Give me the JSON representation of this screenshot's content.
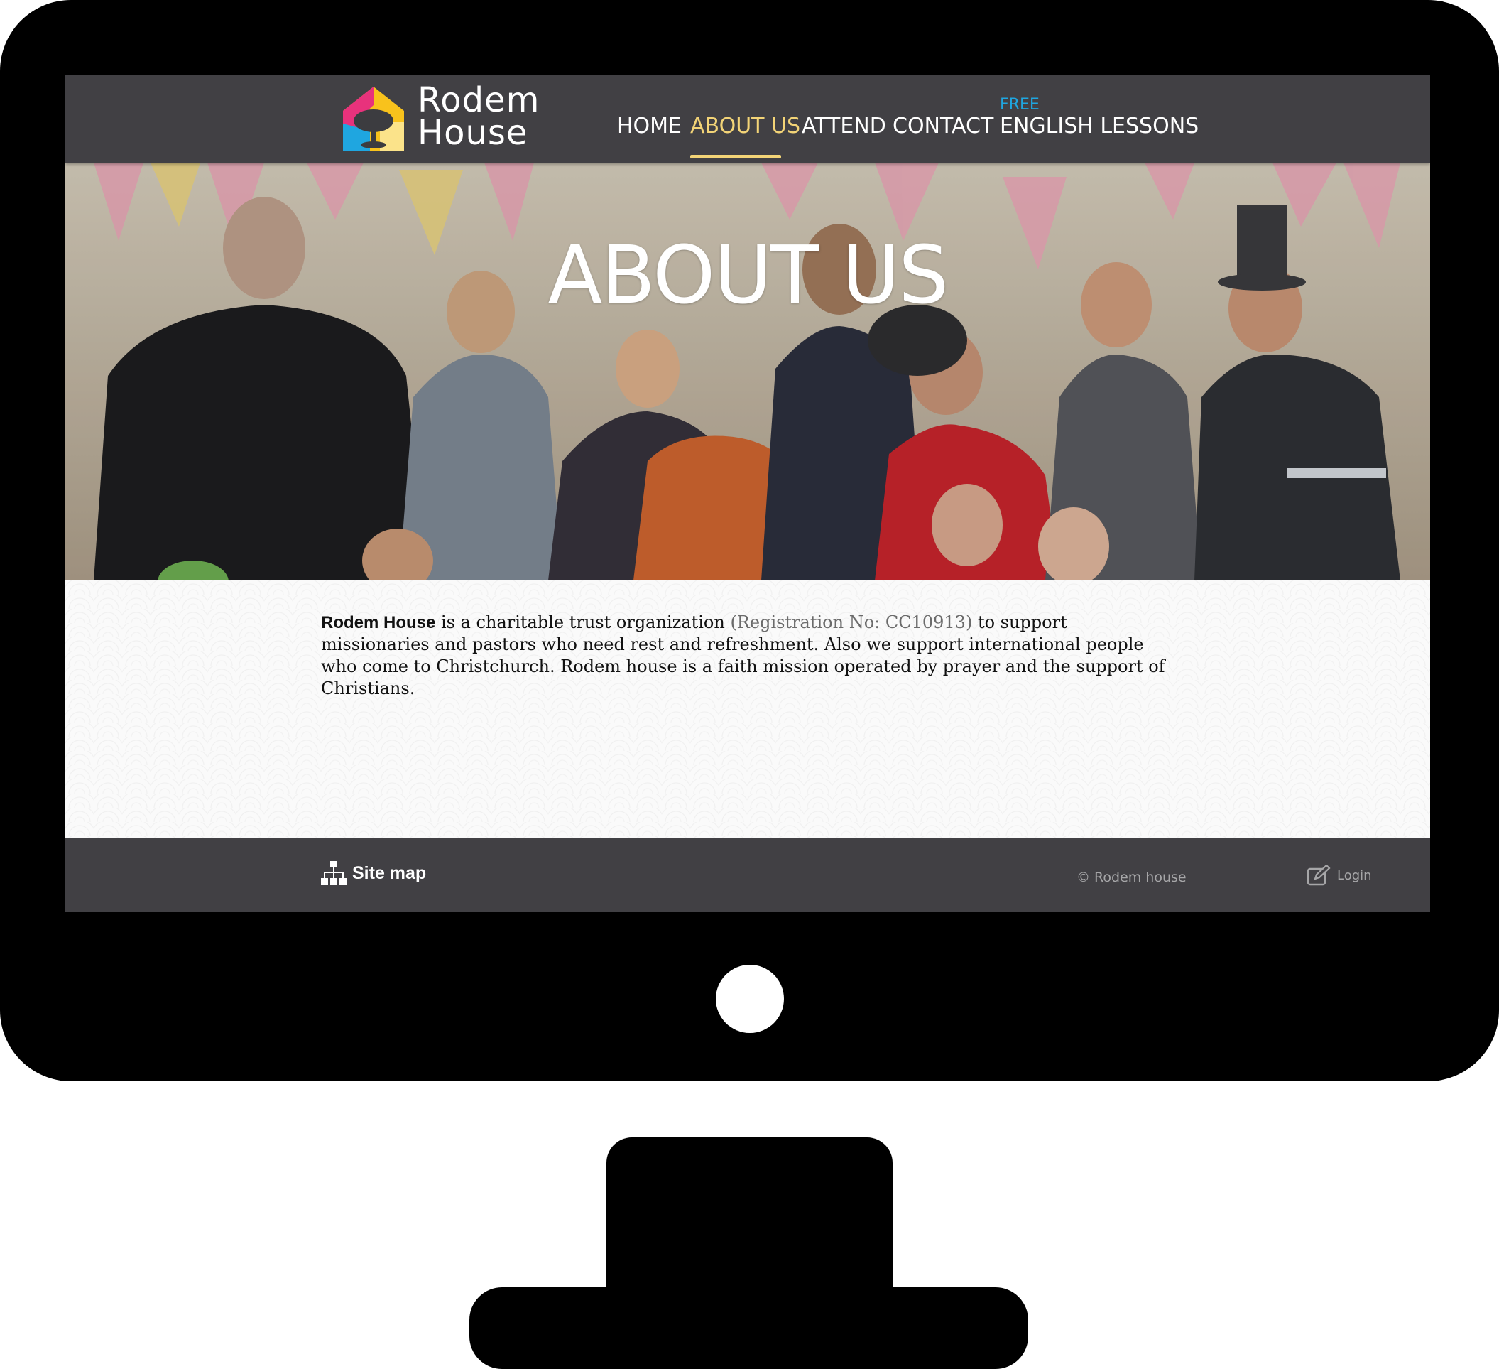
{
  "brand": {
    "logo_line1": "Rodem",
    "logo_line2": "House",
    "logo_icon": "house-tree-icon",
    "colors": {
      "header_bg": "#414044",
      "active_nav": "#f3d477",
      "free_tag": "#1fa6e0",
      "logo_pink": "#e8327c",
      "logo_yellow": "#f8c21c",
      "logo_blue": "#1fa6e0"
    }
  },
  "nav": {
    "items": [
      {
        "label": "HOME",
        "active": false
      },
      {
        "label": "ABOUT US",
        "active": true
      },
      {
        "label": "ATTEND",
        "active": false
      },
      {
        "label": "CONTACT",
        "active": false
      },
      {
        "label": "ENGLISH LESSONS",
        "active": false
      }
    ],
    "free_tag": "FREE"
  },
  "hero": {
    "title": "ABOUT US",
    "image": "group-photo-with-party-props"
  },
  "content": {
    "brand_name": "Rodem House",
    "sentence_part1": " is a charitable trust organization ",
    "registration": "(Registration No: CC10913)",
    "sentence_part2": " to support missionaries and pastors who need rest and refreshment. Also we support international people who come to Christchurch. Rodem house is a faith mission operated by prayer and the support of Christians."
  },
  "footer": {
    "sitemap_label": "Site map",
    "sitemap_icon": "sitemap-icon",
    "copyright": "© Rodem house",
    "login_label": "Login",
    "login_icon": "edit-icon"
  }
}
